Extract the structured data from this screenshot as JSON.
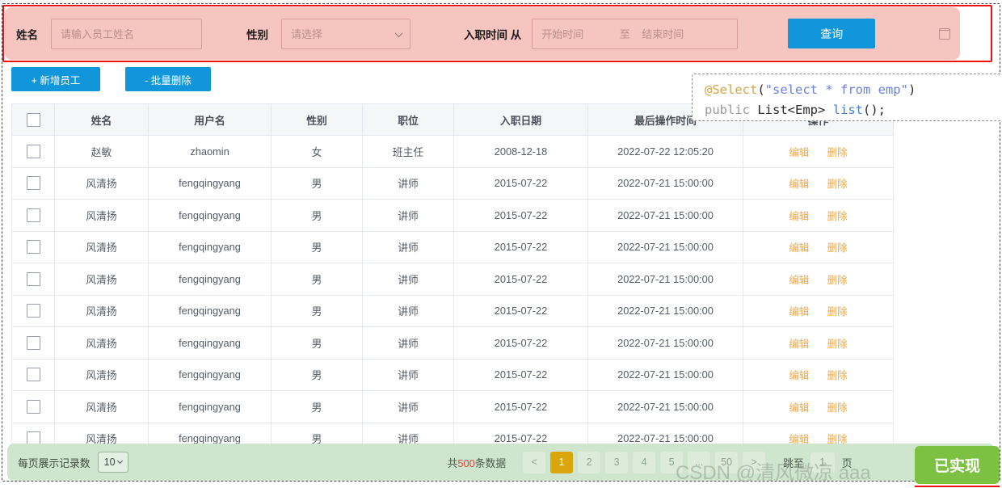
{
  "search_form": {
    "name_label": "姓名",
    "name_placeholder": "请输入员工姓名",
    "gender_label": "性别",
    "gender_placeholder": "请选择",
    "hire_label": "入职时间 从",
    "date_start_placeholder": "开始时间",
    "date_sep": "至",
    "date_end_placeholder": "结束时间",
    "calendar_icon": "calendar-icon",
    "search_button": "查询"
  },
  "actions": {
    "add_label": "+ 新增员工",
    "batch_delete_label": "- 批量删除"
  },
  "table": {
    "headers": [
      "",
      "姓名",
      "用户名",
      "性别",
      "职位",
      "入职日期",
      "最后操作时间",
      "操作"
    ],
    "rows": [
      {
        "name": "赵敏",
        "username": "zhaomin",
        "gender": "女",
        "position": "班主任",
        "hire_date": "2008-12-18",
        "last_op": "2022-07-22 12:05:20"
      },
      {
        "name": "风清扬",
        "username": "fengqingyang",
        "gender": "男",
        "position": "讲师",
        "hire_date": "2015-07-22",
        "last_op": "2022-07-21 15:00:00"
      },
      {
        "name": "风清扬",
        "username": "fengqingyang",
        "gender": "男",
        "position": "讲师",
        "hire_date": "2015-07-22",
        "last_op": "2022-07-21 15:00:00"
      },
      {
        "name": "风清扬",
        "username": "fengqingyang",
        "gender": "男",
        "position": "讲师",
        "hire_date": "2015-07-22",
        "last_op": "2022-07-21 15:00:00"
      },
      {
        "name": "风清扬",
        "username": "fengqingyang",
        "gender": "男",
        "position": "讲师",
        "hire_date": "2015-07-22",
        "last_op": "2022-07-21 15:00:00"
      },
      {
        "name": "风清扬",
        "username": "fengqingyang",
        "gender": "男",
        "position": "讲师",
        "hire_date": "2015-07-22",
        "last_op": "2022-07-21 15:00:00"
      },
      {
        "name": "风清扬",
        "username": "fengqingyang",
        "gender": "男",
        "position": "讲师",
        "hire_date": "2015-07-22",
        "last_op": "2022-07-21 15:00:00"
      },
      {
        "name": "风清扬",
        "username": "fengqingyang",
        "gender": "男",
        "position": "讲师",
        "hire_date": "2015-07-22",
        "last_op": "2022-07-21 15:00:00"
      },
      {
        "name": "风清扬",
        "username": "fengqingyang",
        "gender": "男",
        "position": "讲师",
        "hire_date": "2015-07-22",
        "last_op": "2022-07-21 15:00:00"
      },
      {
        "name": "风清扬",
        "username": "fengqingyang",
        "gender": "男",
        "position": "讲师",
        "hire_date": "2015-07-22",
        "last_op": "2022-07-21 15:00:00"
      }
    ],
    "edit_label": "编辑",
    "delete_label": "删除"
  },
  "footer": {
    "pagesize_label": "每页展示记录数",
    "pagesize_value": "10",
    "total_text_prefix": "共",
    "total_count": "500",
    "total_text_suffix": "条数据",
    "prev_label": "<",
    "next_label": ">",
    "pages": [
      "1",
      "2",
      "3",
      "4",
      "5",
      "...",
      "50"
    ],
    "active_page": "1",
    "jump_label": "跳至",
    "jump_value": "1",
    "jump_unit": "页"
  },
  "code_overlay": {
    "line1": {
      "annotation": "@Select",
      "open": "(",
      "string": "\"select * from emp\"",
      "close": ")"
    },
    "line2": {
      "keyword": "public",
      "type": "List<Emp>",
      "method": "list",
      "tail": "();"
    }
  },
  "badge": {
    "label": "已实现"
  },
  "watermark": {
    "text": "CSDN @清风微凉 aaa"
  },
  "colors": {
    "form_bg": "#f7c5bf",
    "primary_blue": "#1296db",
    "highlight_red": "#ee1111",
    "footer_green": "#cfe5cd",
    "active_page_gold": "#d9a60d",
    "op_link_orange": "#f0a84a",
    "badge_green": "#7cc142",
    "total_red": "#d54a3a"
  }
}
